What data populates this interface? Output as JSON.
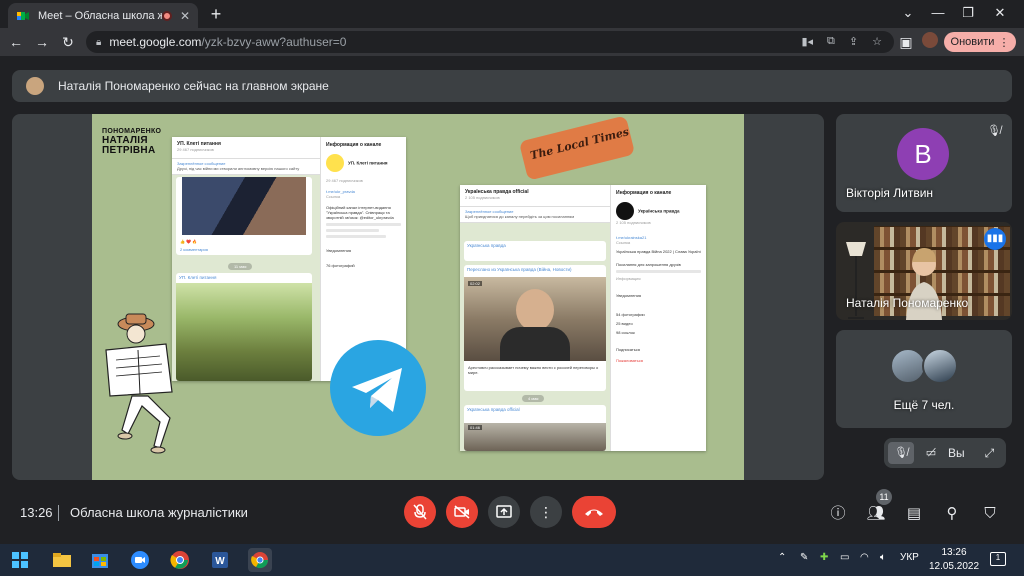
{
  "browser": {
    "tab_title": "Meet – Обласна школа журналістики",
    "new_tab": "+",
    "url_host": "meet.google.com",
    "url_path": "/yzk-bzvy-aww?authuser=0",
    "update_label": "Оновити",
    "window": {
      "minimize": "—",
      "maximize": "❐",
      "close": "✕"
    }
  },
  "presenter_bar": {
    "text": "Наталія Пономаренко сейчас на главном экране"
  },
  "shared_screen": {
    "logo_line1": "ПОНОМАРЕНКО",
    "logo_line2": "НАТАЛІЯ",
    "logo_line3": "ПЕТРІВНА",
    "newspaper_text": "The Local Times",
    "window1": {
      "chat_title": "УП. Клеті питання",
      "chat_subtitle": "29 467 подписчиков",
      "pinned": "Закреплённое сообщение",
      "pinned_text": "Друзі, під час війни ми створили англомовну версію нашого сайту",
      "comments": "2 комментария",
      "info_title": "Информация о канале",
      "channel_name": "УП. Клеті питання",
      "channel_subs": "29 467 подписчиков",
      "link": "t.me/ukr_pravda",
      "link_label": "Ссылка",
      "about": "Офіційний канал інтернет-видання \"Українська правда\". Співпраця та зворотній зв'язок: @editor_ukrpravda",
      "notifications": "Уведомления",
      "photos": "76 фотографий",
      "date_divider": "11 мая",
      "post_channel": "УП. Клеті питання"
    },
    "window2": {
      "chat_title": "Українська правда official",
      "chat_subtitle": "2 105 подписчиков",
      "pinned": "Закреплённое сообщение",
      "pinned_text": "Щоб приєднатися до каналу перейдіть за цим посиланням",
      "forwarded": "Переслано из Українська правда (Війна, Новости)",
      "caption": "Арестович рассказывает почему важно вести с россией переговоры о мире.",
      "date_divider": "4 мая",
      "info_title": "Информация о канале",
      "channel_name": "Українська правда",
      "channel_subs": "2 105 подписчиков",
      "link": "t.me/ukrainska21",
      "link_label": "Ссылка",
      "about": "Українська правда Війна 2022 | Слава Україні",
      "invite": "Посилання для запрошення друзів",
      "invite_label": "Информация",
      "notifications": "Уведомления",
      "photos": "54 фотографии",
      "videos": "25 видео",
      "links": "98 ссылок",
      "subscribe": "Подписаться",
      "leave": "Пожаловаться",
      "video_time": "02:02",
      "video_time2": "01:46"
    }
  },
  "participants": {
    "tile1": {
      "initial": "В",
      "name": "Вікторія Литвин"
    },
    "tile2": {
      "name": "Наталія Пономаренко"
    },
    "tile3": {
      "name": "Ещё 7 чел."
    },
    "self_label": "Вы"
  },
  "bottom_bar": {
    "time": "13:26",
    "meeting_name": "Обласна школа журналістики",
    "participants_count": "11"
  },
  "taskbar": {
    "lang": "УКР",
    "time": "13:26",
    "date": "12.05.2022",
    "notifications": "1"
  },
  "colors": {
    "accent_red": "#ea4335",
    "avatar_purple": "#8e3fb3",
    "telegram_blue": "#2aa5e2",
    "speaking_blue": "#1a73e8"
  }
}
